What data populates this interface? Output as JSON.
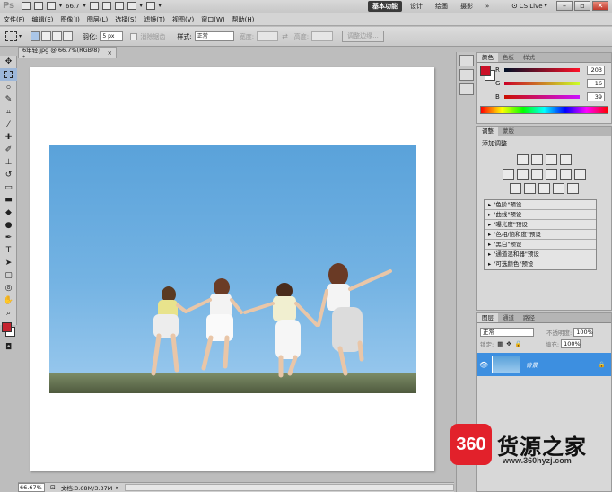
{
  "app": {
    "logo": "Ps",
    "zoom_value": "66.7",
    "workspaces": [
      "基本功能",
      "设计",
      "绘画",
      "摄影"
    ],
    "more": "»",
    "cs_live": "CS Live",
    "window_buttons": [
      "–",
      "▫",
      "✕"
    ]
  },
  "menu": [
    "文件(F)",
    "编辑(E)",
    "图像(I)",
    "图层(L)",
    "选择(S)",
    "滤镜(T)",
    "视图(V)",
    "窗口(W)",
    "帮助(H)"
  ],
  "options": {
    "feather_label": "羽化:",
    "feather_value": "5 px",
    "antialias_label": "消除锯齿",
    "style_label": "样式:",
    "style_value": "正常",
    "width_label": "宽度:",
    "height_label": "高度:",
    "refine_edge": "调整边缘..."
  },
  "document": {
    "tab_title": "6年轻.jpg @ 66.7%(RGB/8) *",
    "tab_close": "×"
  },
  "status": {
    "zoom": "66.67%",
    "doc_info": "文档:3.68M/3.37M"
  },
  "color_panel": {
    "tabs": [
      "颜色",
      "色板",
      "样式"
    ],
    "sliders": [
      {
        "label": "R",
        "value": "203"
      },
      {
        "label": "G",
        "value": "16"
      },
      {
        "label": "B",
        "value": "39"
      }
    ],
    "fg_color": "#cb1027"
  },
  "adjust_panel": {
    "tabs": [
      "调整",
      "蒙版"
    ],
    "title": "添加调整",
    "presets": [
      "\"色阶\"预设",
      "\"曲线\"预设",
      "\"曝光度\"预设",
      "\"色相/饱和度\"预设",
      "\"黑白\"预设",
      "\"通道混和器\"预设",
      "\"可选颜色\"预设"
    ]
  },
  "layers_panel": {
    "tabs": [
      "图层",
      "通道",
      "路径"
    ],
    "blend_mode": "正常",
    "opacity_label": "不透明度:",
    "opacity_value": "100%",
    "lock_label": "锁定:",
    "fill_label": "填充:",
    "fill_value": "100%",
    "layer_name": "背景"
  },
  "watermark": {
    "logo_text": "360",
    "brand": "货源之家",
    "url": "www.360hyzj.com"
  }
}
